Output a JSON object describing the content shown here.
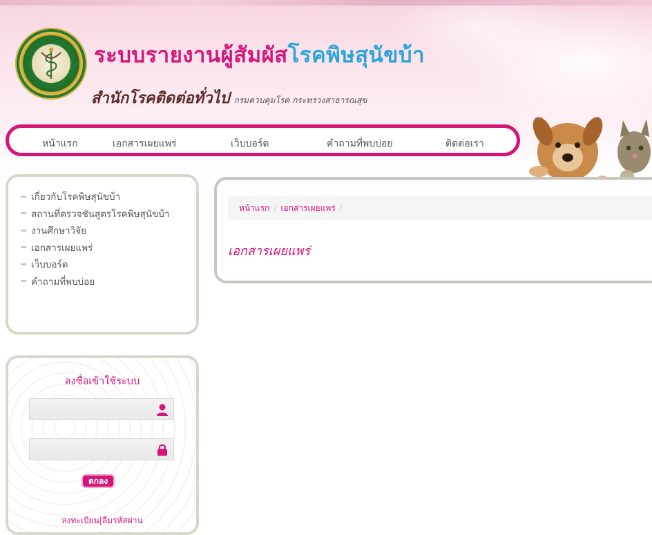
{
  "header": {
    "title_part1": "ระบบรายงานผู้สัมผัส",
    "title_part2": "โรคพิษสุนัขบ้า",
    "subtitle": "สำนักโรคติดต่อทั่วไป",
    "department": "กรมควบคุมโรค กระทรวงสาธารณสุข",
    "logo_alt": "logo-emblem"
  },
  "nav": {
    "items": [
      "หน้าแรก",
      "เอกสารเผยแพร่",
      "เว็บบอร์ด",
      "คำถามที่พบบ่อย",
      "ติดต่อเรา"
    ]
  },
  "sidebar": {
    "menu": [
      "เกี่ยวกับโรคพิษสุนัขบ้า",
      "สถานที่ตรวจชันสูตรโรคพิษสุนัขบ้า",
      "งานศึกษาวิจัย",
      "เอกสารเผยแพร่",
      "เว็บบอร์ด",
      "คำถามที่พบบ่อย"
    ]
  },
  "login": {
    "title": "ลงชื่อเข้าใช้ระบบ",
    "username_value": "",
    "password_value": "",
    "button": "ตกลง",
    "register": "ลงทะเบียน",
    "divider": "|",
    "forgot": "ลืมรหัสผ่าน"
  },
  "content": {
    "breadcrumb": [
      "หน้าแรก",
      "เอกสารเผยแพร่"
    ],
    "breadcrumb_sep": "/",
    "heading": "เอกสารเผยแพร่"
  },
  "colors": {
    "accent": "#d6157a",
    "title_blue": "#2aa5d8",
    "border_gray": "#d9d6cc"
  },
  "icons": [
    "logo-emblem",
    "user-icon",
    "lock-icon",
    "pets-photo"
  ]
}
